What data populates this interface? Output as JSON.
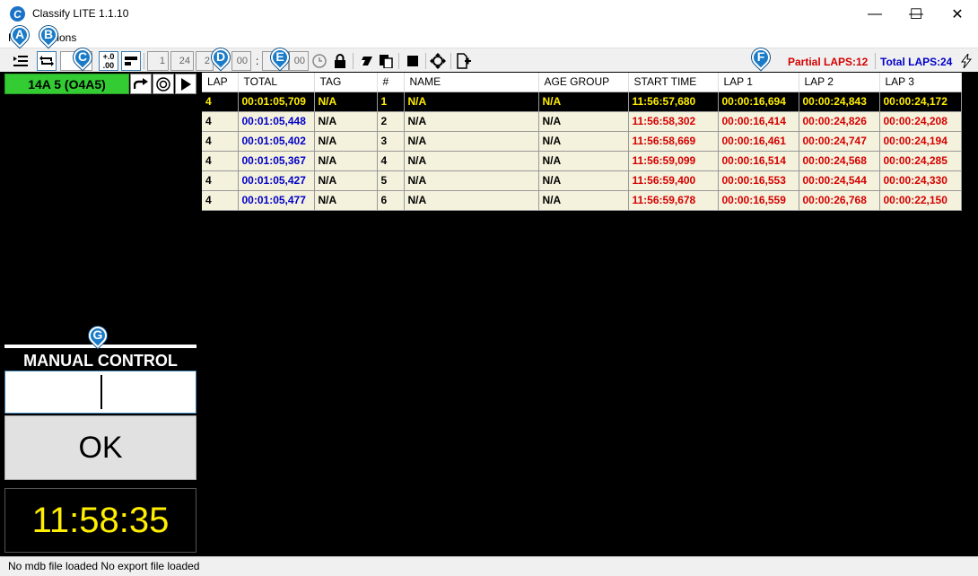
{
  "window": {
    "title": "Classify LITE 1.1.10",
    "icon_letter": "C",
    "minimize_glyph": "—",
    "maximize_glyph": "☐",
    "close_glyph": "✕"
  },
  "menu": {
    "items": [
      "File",
      "Options"
    ]
  },
  "toolbar": {
    "field_1": "1",
    "field_24": "24",
    "field_2": "2",
    "field_00a": "00",
    "colon": ":",
    "field_0": "0",
    "field_00b": "00",
    "partial_laps_label": "Partial LAPS:",
    "partial_laps_value": "12",
    "total_laps_label": "Total LAPS:",
    "total_laps_value": "24"
  },
  "markers": [
    "A",
    "B",
    "C",
    "D",
    "E",
    "F",
    "G"
  ],
  "left_panel": {
    "heat_label": "14A 5 (O4A5)",
    "manual_title": "MANUAL CONTROL",
    "ok_label": "OK",
    "clock": "11:58:35"
  },
  "table": {
    "columns": [
      "LAP",
      "TOTAL",
      "TAG",
      "#",
      "NAME",
      "AGE GROUP",
      "START TIME",
      "LAP 1",
      "LAP 2",
      "LAP 3"
    ],
    "rows": [
      {
        "lap": "4",
        "total": "00:01:05,709",
        "tag": "N/A",
        "num": "1",
        "name": "N/A",
        "age": "N/A",
        "start": "11:56:57,680",
        "lap1": "00:00:16,694",
        "lap2": "00:00:24,843",
        "lap3": "00:00:24,172"
      },
      {
        "lap": "4",
        "total": "00:01:05,448",
        "tag": "N/A",
        "num": "2",
        "name": "N/A",
        "age": "N/A",
        "start": "11:56:58,302",
        "lap1": "00:00:16,414",
        "lap2": "00:00:24,826",
        "lap3": "00:00:24,208"
      },
      {
        "lap": "4",
        "total": "00:01:05,402",
        "tag": "N/A",
        "num": "3",
        "name": "N/A",
        "age": "N/A",
        "start": "11:56:58,669",
        "lap1": "00:00:16,461",
        "lap2": "00:00:24,747",
        "lap3": "00:00:24,194"
      },
      {
        "lap": "4",
        "total": "00:01:05,367",
        "tag": "N/A",
        "num": "4",
        "name": "N/A",
        "age": "N/A",
        "start": "11:56:59,099",
        "lap1": "00:00:16,514",
        "lap2": "00:00:24,568",
        "lap3": "00:00:24,285"
      },
      {
        "lap": "4",
        "total": "00:01:05,427",
        "tag": "N/A",
        "num": "5",
        "name": "N/A",
        "age": "N/A",
        "start": "11:56:59,400",
        "lap1": "00:00:16,553",
        "lap2": "00:00:24,544",
        "lap3": "00:00:24,330"
      },
      {
        "lap": "4",
        "total": "00:01:05,477",
        "tag": "N/A",
        "num": "6",
        "name": "N/A",
        "age": "N/A",
        "start": "11:56:59,678",
        "lap1": "00:00:16,559",
        "lap2": "00:00:26,768",
        "lap3": "00:00:22,150"
      }
    ]
  },
  "status": {
    "mdb": "No mdb file loaded",
    "export": "No export file loaded"
  },
  "colors": {
    "heat_green": "#33cc33",
    "clock_yellow": "#ffee00",
    "total_blue": "#0000c8",
    "time_red": "#d40000",
    "row_bg": "#f4f1dc"
  }
}
